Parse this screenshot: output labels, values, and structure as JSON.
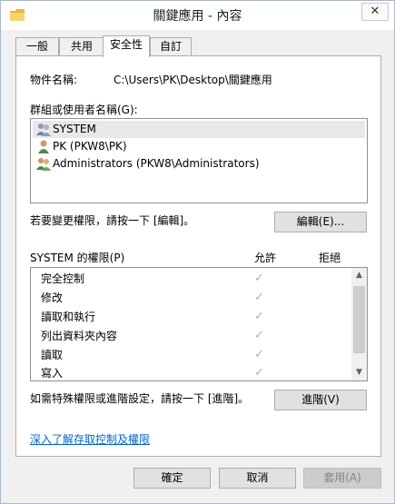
{
  "window": {
    "title": "關鍵應用 - 內容",
    "close_glyph": "✕"
  },
  "tabs": [
    {
      "label": "一般"
    },
    {
      "label": "共用"
    },
    {
      "label": "安全性"
    },
    {
      "label": "自訂"
    }
  ],
  "object": {
    "name_label": "物件名稱:",
    "name_value": "C:\\Users\\PK\\Desktop\\關鍵應用"
  },
  "groups": {
    "label": "群組或使用者名稱(G):",
    "items": [
      {
        "name": "SYSTEM",
        "icon": "group-users-icon"
      },
      {
        "name": "PK (PKW8\\PK)",
        "icon": "user-icon"
      },
      {
        "name": "Administrators (PKW8\\Administrators)",
        "icon": "group-users-icon"
      }
    ]
  },
  "edit": {
    "hint": "若要變更權限，請按一下 [編輯]。",
    "button_label": "編輯(E)..."
  },
  "permissions": {
    "header_label": "SYSTEM 的權限(P)",
    "allow_label": "允許",
    "deny_label": "拒絕",
    "rows": [
      {
        "name": "完全控制",
        "allow": true,
        "deny": false
      },
      {
        "name": "修改",
        "allow": true,
        "deny": false
      },
      {
        "name": "讀取和執行",
        "allow": true,
        "deny": false
      },
      {
        "name": "列出資料夾內容",
        "allow": true,
        "deny": false
      },
      {
        "name": "讀取",
        "allow": true,
        "deny": false
      },
      {
        "name": "寫入",
        "allow": true,
        "deny": false
      }
    ],
    "check_glyph": "✓"
  },
  "advanced": {
    "hint": "如需特殊權限或進階設定，請按一下 [進階]。",
    "button_label": "進階(V)"
  },
  "learn_link": "深入了解存取控制及權限",
  "footer": {
    "ok_label": "確定",
    "cancel_label": "取消",
    "apply_label": "套用(A)"
  },
  "colors": {
    "link": "#0066cc",
    "folder": "#e8b73b"
  }
}
